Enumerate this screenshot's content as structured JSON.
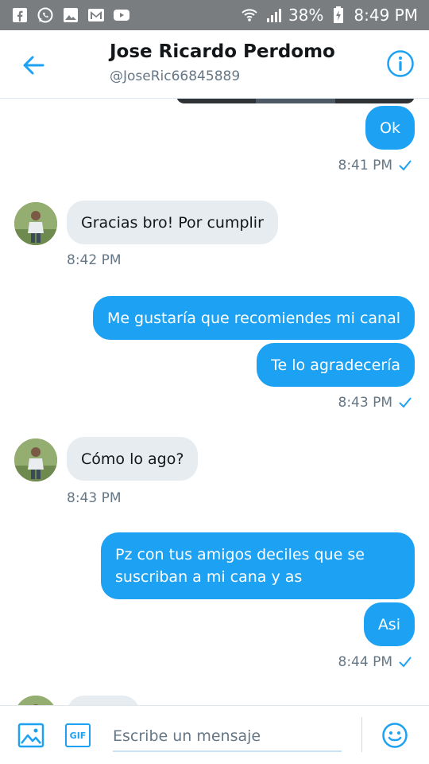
{
  "status_bar": {
    "battery": "38%",
    "time": "8:49 PM"
  },
  "header": {
    "name": "Jose Ricardo Perdomo",
    "handle": "@JoseRic66845889"
  },
  "messages": [
    {
      "text": "Ok"
    },
    {
      "time": "8:41 PM"
    },
    {
      "text": "Gracias bro! Por cumplir"
    },
    {
      "time": "8:42 PM"
    },
    {
      "text": "Me gustaría que recomiendes mi canal"
    },
    {
      "text": "Te lo agradecería"
    },
    {
      "time": "8:43 PM"
    },
    {
      "text": "Cómo  lo ago?"
    },
    {
      "time": "8:43 PM"
    },
    {
      "line1": "Pz con tus amigos deciles que se",
      "line2": "suscriban a mi cana y as"
    },
    {
      "text": "Asi"
    },
    {
      "time": "8:44 PM"
    }
  ],
  "composer": {
    "placeholder": "Escribe un mensaje",
    "gif_label": "GIF"
  },
  "colors": {
    "accent": "#1da1f2",
    "incoming_bubble": "#e6ecf0",
    "status_bar": "#7a7d80"
  }
}
